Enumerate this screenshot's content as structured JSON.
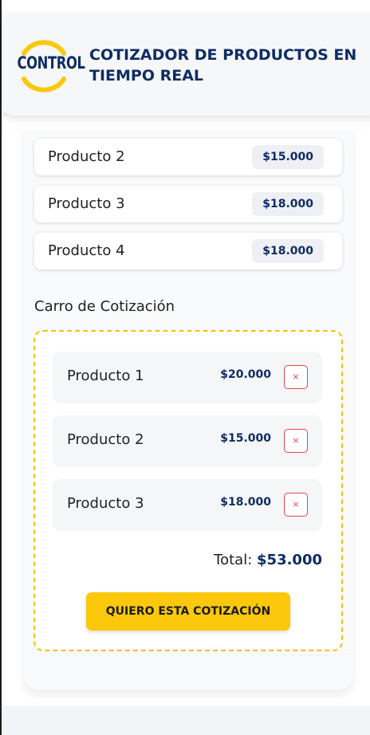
{
  "header": {
    "logo_text": "CONTROL",
    "title": "COTIZADOR DE PRODUCTOS EN TIEMPO REAL"
  },
  "catalog": {
    "items": [
      {
        "name": "Producto 2",
        "price": "$15.000"
      },
      {
        "name": "Producto 3",
        "price": "$18.000"
      },
      {
        "name": "Producto 4",
        "price": "$18.000"
      }
    ]
  },
  "cart": {
    "title": "Carro de Cotización",
    "items": [
      {
        "name": "Producto 1",
        "price": "$20.000",
        "remove_label": "×"
      },
      {
        "name": "Producto 2",
        "price": "$15.000",
        "remove_label": "×"
      },
      {
        "name": "Producto 3",
        "price": "$18.000",
        "remove_label": "×"
      }
    ],
    "total_label": "Total:",
    "total_value": "$53.000",
    "cta_label": "QUIERO ESTA COTIZACIÓN"
  },
  "colors": {
    "brand_navy": "#0f2d64",
    "accent_yellow": "#fcc80c",
    "remove_red": "#d94a4a"
  },
  "icons": {
    "remove": "close-icon",
    "logo_ring": "logo-ring-icon"
  }
}
